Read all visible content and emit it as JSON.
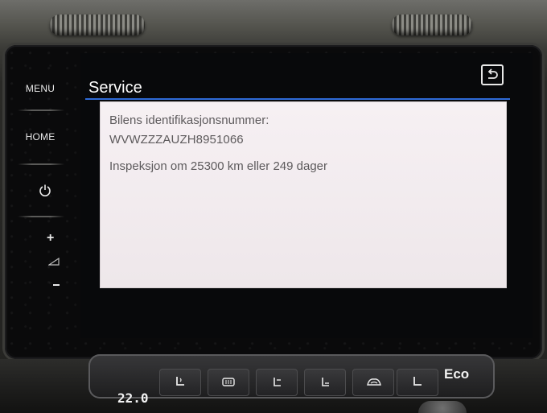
{
  "side_buttons": {
    "menu_label": "MENU",
    "home_label": "HOME",
    "volume_plus": "+"
  },
  "screen": {
    "title": "Service",
    "panel": {
      "vin_label": "Bilens identifikasjonsnummer:",
      "vin_value": "WVWZZZAUZH8951066",
      "inspection_text": "Inspeksjon om 25300 km eller 249 dager"
    }
  },
  "climate": {
    "temperature": "22.0",
    "eco_label": "Eco"
  },
  "colors": {
    "accent_line": "#2f6bd8",
    "panel_background": "#f6f0f3",
    "panel_text": "#5d5a5c"
  },
  "icons": [
    "power-icon",
    "volume-icon",
    "back-icon",
    "seat-heat-icon",
    "rear-defrost-icon",
    "airflow-icon",
    "windshield-icon",
    "recirculation-icon"
  ]
}
